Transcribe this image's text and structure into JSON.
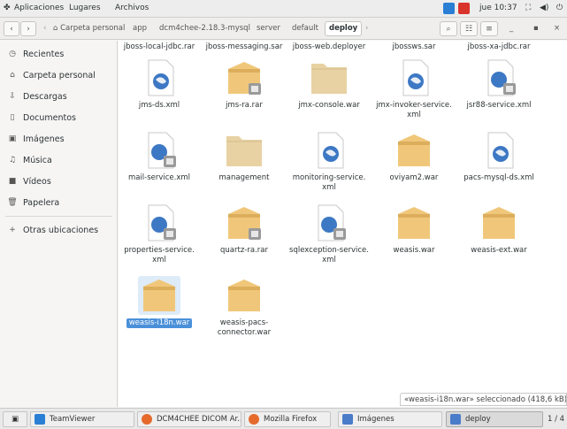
{
  "topbar": {
    "apps": "Aplicaciones",
    "places": "Lugares",
    "app_menu": "Archivos",
    "clock": "jue 10:37"
  },
  "header": {
    "back_glyph": "‹",
    "forward_glyph": "›",
    "breadcrumbs": [
      "Carpeta personal",
      "app",
      "dcm4chee-2.18.3-mysql",
      "server",
      "default",
      "deploy"
    ]
  },
  "sidebar": {
    "items": [
      {
        "label": "Recientes",
        "icon": "clock-icon"
      },
      {
        "label": "Carpeta personal",
        "icon": "home-icon"
      },
      {
        "label": "Descargas",
        "icon": "download-icon"
      },
      {
        "label": "Documentos",
        "icon": "document-icon"
      },
      {
        "label": "Imágenes",
        "icon": "image-icon"
      },
      {
        "label": "Música",
        "icon": "music-icon"
      },
      {
        "label": "Vídeos",
        "icon": "video-icon"
      },
      {
        "label": "Papelera",
        "icon": "trash-icon"
      },
      {
        "label": "Otras ubicaciones",
        "icon": "plus-icon"
      }
    ]
  },
  "files": {
    "row0": [
      {
        "name": "jboss-local-jdbc.rar"
      },
      {
        "name": "jboss-messaging.sar"
      },
      {
        "name": "jboss-web.deployer"
      },
      {
        "name": "jbossws.sar"
      },
      {
        "name": "jboss-xa-jdbc.rar"
      }
    ],
    "row1": [
      {
        "name": "jms-ds.xml",
        "type": "xml"
      },
      {
        "name": "jms-ra.rar",
        "type": "archive-locked"
      },
      {
        "name": "jmx-console.war",
        "type": "folder"
      },
      {
        "name": "jmx-invoker-service.\nxml",
        "type": "xml"
      },
      {
        "name": "jsr88-service.xml",
        "type": "xml-locked"
      }
    ],
    "row2": [
      {
        "name": "mail-service.xml",
        "type": "xml-locked"
      },
      {
        "name": "management",
        "type": "folder"
      },
      {
        "name": "monitoring-service.\nxml",
        "type": "xml"
      },
      {
        "name": "oviyam2.war",
        "type": "archive"
      },
      {
        "name": "pacs-mysql-ds.xml",
        "type": "xml"
      }
    ],
    "row3": [
      {
        "name": "properties-service.\nxml",
        "type": "xml-locked"
      },
      {
        "name": "quartz-ra.rar",
        "type": "archive-locked"
      },
      {
        "name": "sqlexception-service.\nxml",
        "type": "xml-locked"
      },
      {
        "name": "weasis.war",
        "type": "archive"
      },
      {
        "name": "weasis-ext.war",
        "type": "archive"
      }
    ],
    "row4": [
      {
        "name": "weasis-i18n.war",
        "type": "archive",
        "selected": true
      },
      {
        "name": "weasis-pacs-\nconnector.war",
        "type": "archive"
      }
    ]
  },
  "status": "«weasis-i18n.war» seleccionado (418,6 kB)",
  "taskbar": {
    "tasks": [
      {
        "label": "TeamViewer",
        "color": "#2a7fd4"
      },
      {
        "label": "DCM4CHEE DICOM Ar...",
        "color": "#e66a2c"
      },
      {
        "label": "Mozilla Firefox",
        "color": "#e66a2c"
      },
      {
        "label": "Imágenes",
        "color": "#4a7cc9"
      },
      {
        "label": "deploy",
        "color": "#4a7cc9"
      }
    ],
    "pager": "1 / 4"
  },
  "colors": {
    "selection": "#4a90d9",
    "folder": "#e8d2a4",
    "archive": "#f0c77a"
  }
}
